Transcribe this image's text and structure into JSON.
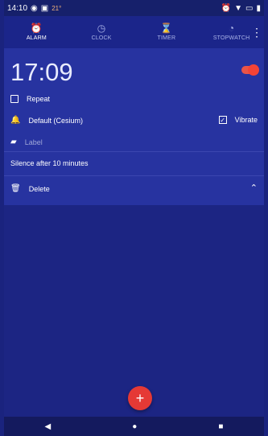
{
  "statusbar": {
    "time": "14:10",
    "left_icons": [
      "chrome-icon",
      "photo-icon"
    ],
    "temp": "21°",
    "right_icons": [
      "alarm-icon",
      "wifi-icon",
      "battery-icon",
      "signal-icon"
    ]
  },
  "tabs": [
    {
      "label": "ALARM",
      "icon": "alarm-clock-icon",
      "active": true
    },
    {
      "label": "CLOCK",
      "icon": "clock-icon",
      "active": false
    },
    {
      "label": "TIMER",
      "icon": "hourglass-icon",
      "active": false
    },
    {
      "label": "STOPWATCH",
      "icon": "stopwatch-icon",
      "active": false
    }
  ],
  "alarm": {
    "time": "17:09",
    "enabled": true,
    "repeat_label": "Repeat",
    "ringtone_label": "Default (Cesium)",
    "vibrate_label": "Vibrate",
    "label_placeholder": "Label",
    "silence_text": "Silence after 10 minutes",
    "delete_label": "Delete"
  },
  "fab_label": "+",
  "colors": {
    "background": "#1a237e",
    "card": "#2733a0",
    "accent": "#f44336"
  }
}
